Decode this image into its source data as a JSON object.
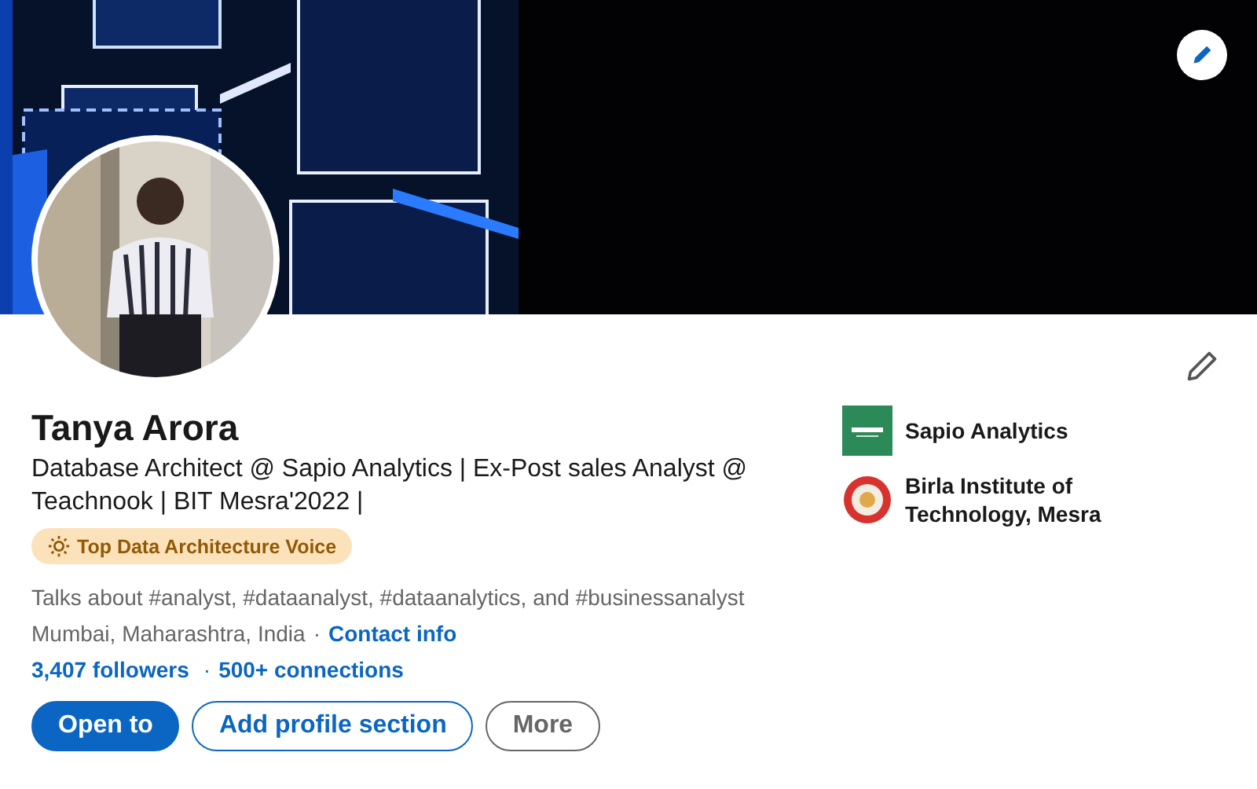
{
  "profile": {
    "name": "Tanya Arora",
    "headline": "Database Architect @ Sapio Analytics | Ex-Post sales Analyst @ Teachnook | BIT Mesra'2022 |",
    "badge": "Top Data Architecture Voice",
    "talks_about": "Talks about #analyst, #dataanalyst, #dataanalytics, and #businessanalyst",
    "location": "Mumbai, Maharashtra, India",
    "location_separator": "·",
    "contact_link": "Contact info",
    "followers": "3,407 followers",
    "connections_separator": "·",
    "connections": "500+ connections"
  },
  "buttons": [
    {
      "label": "Open to",
      "kind": "primary"
    },
    {
      "label": "Add profile section",
      "kind": "outline"
    },
    {
      "label": "More",
      "kind": "neutral"
    }
  ],
  "organizations": [
    {
      "name": "Sapio Analytics",
      "kind": "company"
    },
    {
      "name": "Birla Institute of Technology, Mesra",
      "kind": "school"
    }
  ]
}
